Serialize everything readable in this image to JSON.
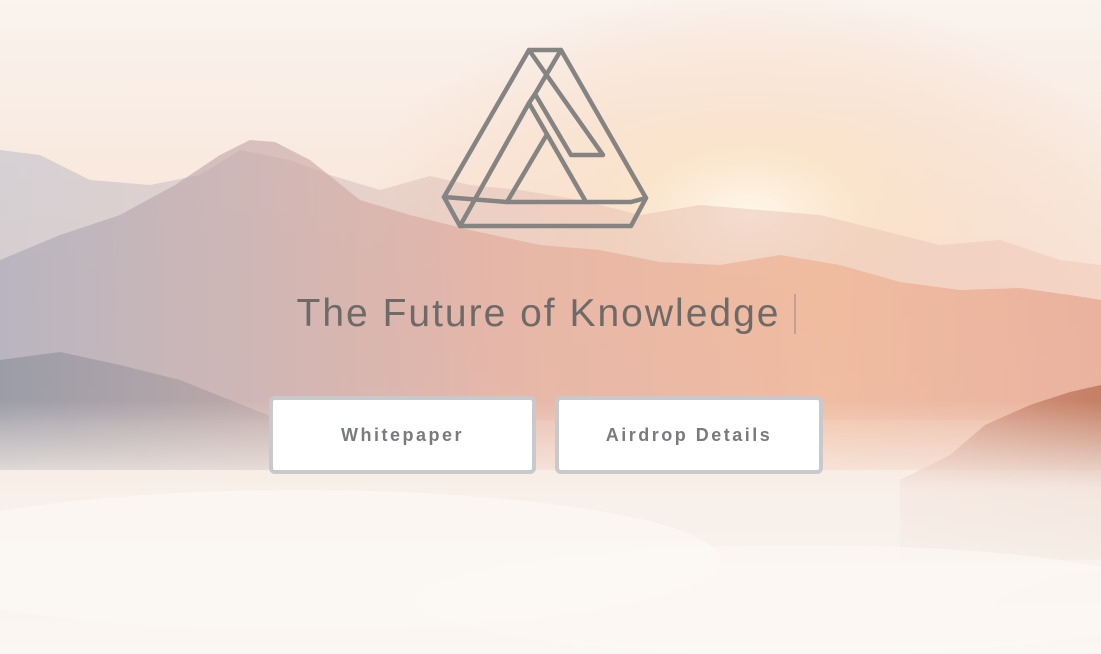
{
  "hero": {
    "headline": "The Future of Knowledge",
    "logo_icon": "impossible-triangle-icon",
    "buttons": [
      {
        "label": "Whitepaper"
      },
      {
        "label": "Airdrop Details"
      }
    ]
  },
  "colors": {
    "headline": "#6e6a68",
    "button_text": "#7a7b80",
    "button_border": "#c9c9cc",
    "logo_stroke": "#858482"
  }
}
